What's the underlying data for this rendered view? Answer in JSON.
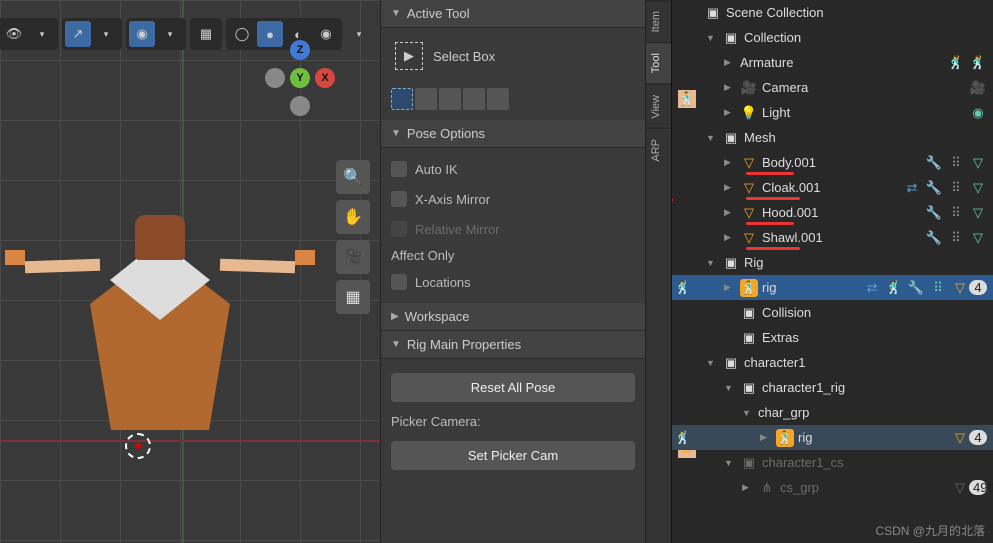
{
  "viewport": {
    "gizmo": {
      "x": "X",
      "y": "Y",
      "z": "Z"
    },
    "tool_buttons": [
      "zoom",
      "hand",
      "camera",
      "grid"
    ]
  },
  "npanel": {
    "tabs": [
      "Item",
      "Tool",
      "View",
      "ARP"
    ],
    "active_tab": "Tool",
    "panels": {
      "active_tool": {
        "title": "Active Tool",
        "tool": "Select Box"
      },
      "pose_options": {
        "title": "Pose Options",
        "auto_ik": "Auto IK",
        "xmirror": "X-Axis Mirror",
        "relmirror": "Relative Mirror",
        "affect_only": "Affect Only",
        "locations": "Locations"
      },
      "workspace": {
        "title": "Workspace"
      },
      "rig_main": {
        "title": "Rig Main Properties",
        "reset": "Reset All Pose",
        "picker_label": "Picker Camera:",
        "set_picker": "Set Picker Cam"
      }
    }
  },
  "outliner": {
    "items": [
      {
        "ind": 0,
        "tri": "",
        "icon": "scene",
        "label": "Scene Collection"
      },
      {
        "ind": 1,
        "tri": "▼",
        "icon": "col",
        "label": "Collection"
      },
      {
        "ind": 2,
        "tri": "▶",
        "icon": "arm",
        "label": "Armature",
        "ricons": [
          "pose-teal",
          "pose-teal"
        ]
      },
      {
        "ind": 2,
        "tri": "▶",
        "icon": "cam",
        "label": "Camera",
        "ricons": [
          "cam-teal"
        ]
      },
      {
        "ind": 2,
        "tri": "▶",
        "icon": "light",
        "label": "Light",
        "ricons": [
          "bulb-teal"
        ]
      },
      {
        "ind": 1,
        "tri": "▼",
        "icon": "col",
        "label": "Mesh"
      },
      {
        "ind": 2,
        "tri": "▶",
        "icon": "mesh",
        "label": "Body.001",
        "ricons": [
          "wrench",
          "mod",
          "tri-teal"
        ],
        "mark": true
      },
      {
        "ind": 2,
        "tri": "▶",
        "icon": "mesh",
        "label": "Cloak.001",
        "ricons": [
          "link",
          "wrench",
          "mod",
          "tri-teal"
        ],
        "mark": true
      },
      {
        "ind": 2,
        "tri": "▶",
        "icon": "mesh",
        "label": "Hood.001",
        "ricons": [
          "wrench",
          "mod",
          "tri-teal"
        ],
        "mark": true
      },
      {
        "ind": 2,
        "tri": "▶",
        "icon": "mesh",
        "label": "Shawl.001",
        "ricons": [
          "wrench",
          "mod",
          "tri-teal"
        ],
        "mark": true
      },
      {
        "ind": 1,
        "tri": "▼",
        "icon": "col",
        "label": "Rig"
      },
      {
        "ind": 2,
        "tri": "▶",
        "icon": "arm-sel",
        "label": "rig",
        "sel": true,
        "ricons": [
          "link",
          "pose-teal",
          "wrench",
          "mod-teal",
          "tri-o",
          "badge4"
        ]
      },
      {
        "ind": 2,
        "tri": "",
        "icon": "col",
        "label": "Collision"
      },
      {
        "ind": 2,
        "tri": "",
        "icon": "col",
        "label": "Extras"
      },
      {
        "ind": 1,
        "tri": "▼",
        "icon": "col",
        "label": "character1"
      },
      {
        "ind": 2,
        "tri": "▼",
        "icon": "col",
        "label": "character1_rig"
      },
      {
        "ind": 3,
        "tri": "▼",
        "icon": "grp",
        "label": "char_grp"
      },
      {
        "ind": 4,
        "tri": "▶",
        "icon": "arm-sel",
        "label": "rig",
        "sel2": true,
        "ricons": [
          "tri-o",
          "badge4"
        ]
      },
      {
        "ind": 2,
        "tri": "▼",
        "icon": "col-dim",
        "label": "character1_cs",
        "dim": true
      },
      {
        "ind": 3,
        "tri": "▶",
        "icon": "grp-dim",
        "label": "cs_grp",
        "dim": true,
        "ricons": [
          "tri-dim",
          "badge499"
        ]
      }
    ]
  },
  "watermark": "CSDN @九月的北落"
}
